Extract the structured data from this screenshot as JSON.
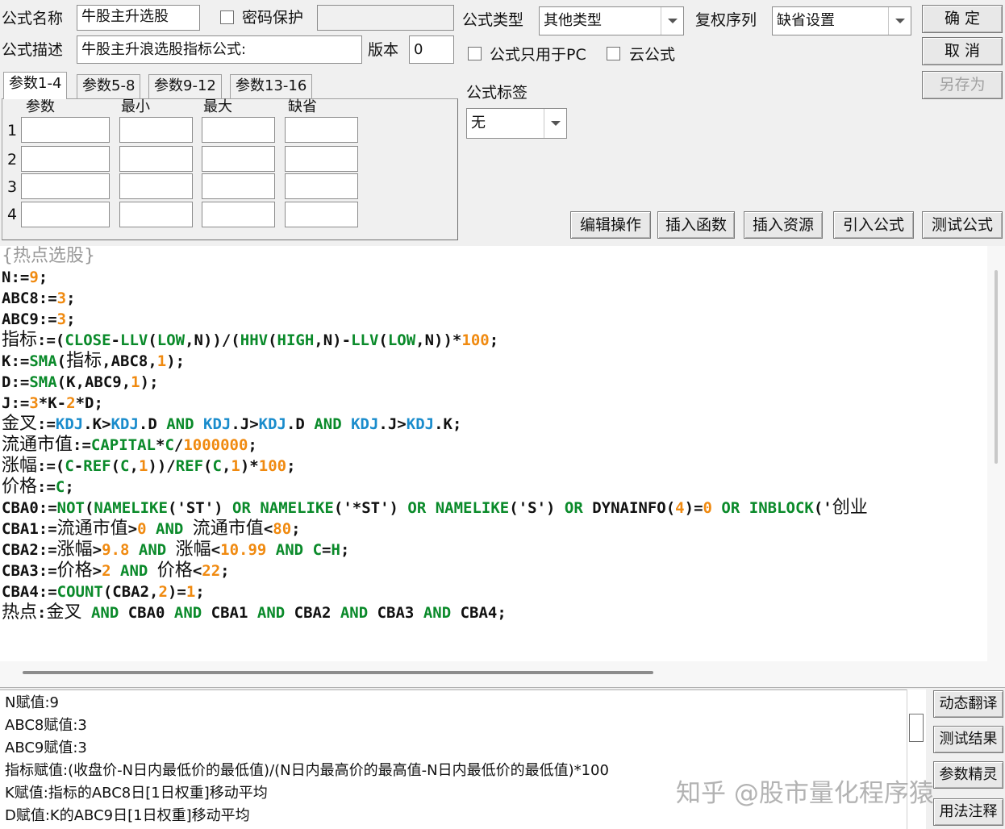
{
  "form": {
    "name_label": "公式名称",
    "name_value": "牛股主升选股",
    "password_label": "密码保护",
    "desc_label": "公式描述",
    "desc_value": "牛股主升浪选股指标公式:",
    "version_label": "版本",
    "version_value": "0",
    "type_label": "公式类型",
    "type_value": "其他类型",
    "adjust_label": "复权序列",
    "adjust_value": "缺省设置",
    "pc_only_label": "公式只用于PC",
    "cloud_label": "云公式",
    "tag_label": "公式标签",
    "tag_value": "无"
  },
  "buttons": {
    "ok": "确 定",
    "cancel": "取 消",
    "save_as": "另存为",
    "edit_ops": "编辑操作",
    "insert_func": "插入函数",
    "insert_res": "插入资源",
    "import_formula": "引入公式",
    "test_formula": "测试公式",
    "dyn_translate": "动态翻译",
    "test_result": "测试结果",
    "param_wizard": "参数精灵",
    "usage_notes": "用法注释"
  },
  "params": {
    "tabs": [
      "参数1-4",
      "参数5-8",
      "参数9-12",
      "参数13-16"
    ],
    "headers": [
      "参数",
      "最小",
      "最大",
      "缺省"
    ],
    "rows": [
      "1",
      "2",
      "3",
      "4"
    ]
  },
  "code": {
    "comment": "{热点选股}",
    "lines": [
      [
        [
          "N:=",
          "k"
        ],
        [
          "9",
          "o"
        ],
        [
          ";",
          "k"
        ]
      ],
      [
        [
          "ABC8:=",
          "k"
        ],
        [
          "3",
          "o"
        ],
        [
          ";",
          "k"
        ]
      ],
      [
        [
          "ABC9:=",
          "k"
        ],
        [
          "3",
          "o"
        ],
        [
          ";",
          "k"
        ]
      ],
      [
        [
          "指标",
          "cn"
        ],
        [
          ":=(",
          "k"
        ],
        [
          "CLOSE",
          "g"
        ],
        [
          "-",
          "k"
        ],
        [
          "LLV",
          "g"
        ],
        [
          "(",
          "k"
        ],
        [
          "LOW",
          "g"
        ],
        [
          ",N))/(",
          "k"
        ],
        [
          "HHV",
          "g"
        ],
        [
          "(",
          "k"
        ],
        [
          "HIGH",
          "g"
        ],
        [
          ",N)-",
          "k"
        ],
        [
          "LLV",
          "g"
        ],
        [
          "(",
          "k"
        ],
        [
          "LOW",
          "g"
        ],
        [
          ",N))*",
          "k"
        ],
        [
          "100",
          "o"
        ],
        [
          ";",
          "k"
        ]
      ],
      [
        [
          "K:=",
          "k"
        ],
        [
          "SMA",
          "g"
        ],
        [
          "(",
          "k"
        ],
        [
          "指标",
          "cn"
        ],
        [
          ",ABC8,",
          "k"
        ],
        [
          "1",
          "o"
        ],
        [
          ");",
          "k"
        ]
      ],
      [
        [
          "D:=",
          "k"
        ],
        [
          "SMA",
          "g"
        ],
        [
          "(K,ABC9,",
          "k"
        ],
        [
          "1",
          "o"
        ],
        [
          ");",
          "k"
        ]
      ],
      [
        [
          "J:=",
          "k"
        ],
        [
          "3",
          "o"
        ],
        [
          "*K-",
          "k"
        ],
        [
          "2",
          "o"
        ],
        [
          "*D;",
          "k"
        ]
      ],
      [
        [
          "金叉",
          "cn"
        ],
        [
          ":=",
          "k"
        ],
        [
          "KDJ",
          "b"
        ],
        [
          ".K>",
          "k"
        ],
        [
          "KDJ",
          "b"
        ],
        [
          ".D ",
          "k"
        ],
        [
          "AND",
          "g"
        ],
        [
          " ",
          "k"
        ],
        [
          "KDJ",
          "b"
        ],
        [
          ".J>",
          "k"
        ],
        [
          "KDJ",
          "b"
        ],
        [
          ".D ",
          "k"
        ],
        [
          "AND",
          "g"
        ],
        [
          " ",
          "k"
        ],
        [
          "KDJ",
          "b"
        ],
        [
          ".J>",
          "k"
        ],
        [
          "KDJ",
          "b"
        ],
        [
          ".K;",
          "k"
        ]
      ],
      [
        [
          "流通市值",
          "cn"
        ],
        [
          ":=",
          "k"
        ],
        [
          "CAPITAL",
          "g"
        ],
        [
          "*",
          "k"
        ],
        [
          "C",
          "g"
        ],
        [
          "/",
          "k"
        ],
        [
          "1000000",
          "o"
        ],
        [
          ";",
          "k"
        ]
      ],
      [
        [
          "涨幅",
          "cn"
        ],
        [
          ":=(",
          "k"
        ],
        [
          "C",
          "g"
        ],
        [
          "-",
          "k"
        ],
        [
          "REF",
          "g"
        ],
        [
          "(",
          "k"
        ],
        [
          "C",
          "g"
        ],
        [
          ",",
          "k"
        ],
        [
          "1",
          "o"
        ],
        [
          "))/",
          "k"
        ],
        [
          "REF",
          "g"
        ],
        [
          "(",
          "k"
        ],
        [
          "C",
          "g"
        ],
        [
          ",",
          "k"
        ],
        [
          "1",
          "o"
        ],
        [
          ")*",
          "k"
        ],
        [
          "100",
          "o"
        ],
        [
          ";",
          "k"
        ]
      ],
      [
        [
          "价格",
          "cn"
        ],
        [
          ":=",
          "k"
        ],
        [
          "C",
          "g"
        ],
        [
          ";",
          "k"
        ]
      ],
      [
        [
          "CBA0:=",
          "k"
        ],
        [
          "NOT",
          "g"
        ],
        [
          "(",
          "k"
        ],
        [
          "NAMELIKE",
          "g"
        ],
        [
          "('ST') ",
          "k"
        ],
        [
          "OR",
          "g"
        ],
        [
          " ",
          "k"
        ],
        [
          "NAMELIKE",
          "g"
        ],
        [
          "('*ST') ",
          "k"
        ],
        [
          "OR",
          "g"
        ],
        [
          " ",
          "k"
        ],
        [
          "NAMELIKE",
          "g"
        ],
        [
          "('S') ",
          "k"
        ],
        [
          "OR",
          "g"
        ],
        [
          " DYNAINFO(",
          "k"
        ],
        [
          "4",
          "o"
        ],
        [
          ")=",
          "k"
        ],
        [
          "0",
          "o"
        ],
        [
          " ",
          "k"
        ],
        [
          "OR",
          "g"
        ],
        [
          " ",
          "k"
        ],
        [
          "INBLOCK",
          "g"
        ],
        [
          "('",
          "k"
        ],
        [
          "创业",
          "cn"
        ]
      ],
      [
        [
          "CBA1:=",
          "k"
        ],
        [
          "流通市值",
          "cn"
        ],
        [
          ">",
          "k"
        ],
        [
          "0",
          "o"
        ],
        [
          " ",
          "k"
        ],
        [
          "AND",
          "g"
        ],
        [
          " ",
          "k"
        ],
        [
          "流通市值",
          "cn"
        ],
        [
          "<",
          "k"
        ],
        [
          "80",
          "o"
        ],
        [
          ";",
          "k"
        ]
      ],
      [
        [
          "CBA2:=",
          "k"
        ],
        [
          "涨幅",
          "cn"
        ],
        [
          ">",
          "k"
        ],
        [
          "9.8",
          "o"
        ],
        [
          " ",
          "k"
        ],
        [
          "AND",
          "g"
        ],
        [
          " ",
          "k"
        ],
        [
          "涨幅",
          "cn"
        ],
        [
          "<",
          "k"
        ],
        [
          "10.99",
          "o"
        ],
        [
          " ",
          "k"
        ],
        [
          "AND",
          "g"
        ],
        [
          " ",
          "k"
        ],
        [
          "C",
          "g"
        ],
        [
          "=",
          "k"
        ],
        [
          "H",
          "g"
        ],
        [
          ";",
          "k"
        ]
      ],
      [
        [
          "CBA3:=",
          "k"
        ],
        [
          "价格",
          "cn"
        ],
        [
          ">",
          "k"
        ],
        [
          "2",
          "o"
        ],
        [
          " ",
          "k"
        ],
        [
          "AND",
          "g"
        ],
        [
          " ",
          "k"
        ],
        [
          "价格",
          "cn"
        ],
        [
          "<",
          "k"
        ],
        [
          "22",
          "o"
        ],
        [
          ";",
          "k"
        ]
      ],
      [
        [
          "CBA4:=",
          "k"
        ],
        [
          "COUNT",
          "g"
        ],
        [
          "(CBA2,",
          "k"
        ],
        [
          "2",
          "o"
        ],
        [
          ")=",
          "k"
        ],
        [
          "1",
          "o"
        ],
        [
          ";",
          "k"
        ]
      ],
      [
        [
          "热点",
          "cn"
        ],
        [
          ":",
          "k"
        ],
        [
          "金叉",
          "cn"
        ],
        [
          " ",
          "k"
        ],
        [
          "AND",
          "g"
        ],
        [
          " CBA0 ",
          "k"
        ],
        [
          "AND",
          "g"
        ],
        [
          " CBA1 ",
          "k"
        ],
        [
          "AND",
          "g"
        ],
        [
          " CBA2 ",
          "k"
        ],
        [
          "AND",
          "g"
        ],
        [
          " CBA3 ",
          "k"
        ],
        [
          "AND",
          "g"
        ],
        [
          " CBA4;",
          "k"
        ]
      ]
    ]
  },
  "output": {
    "lines": [
      "N赋值:9",
      "ABC8赋值:3",
      "ABC9赋值:3",
      "指标赋值:(收盘价-N日内最低价的最低值)/(N日内最高价的最高值-N日内最低价的最低值)*100",
      "K赋值:指标的ABC8日[1日权重]移动平均",
      "D赋值:K的ABC9日[1日权重]移动平均"
    ]
  },
  "watermark": "知乎 @股市量化程序猿",
  "colors": {
    "function": "#0a8a2a",
    "number": "#f08a10",
    "reference": "#1a8ccc"
  }
}
